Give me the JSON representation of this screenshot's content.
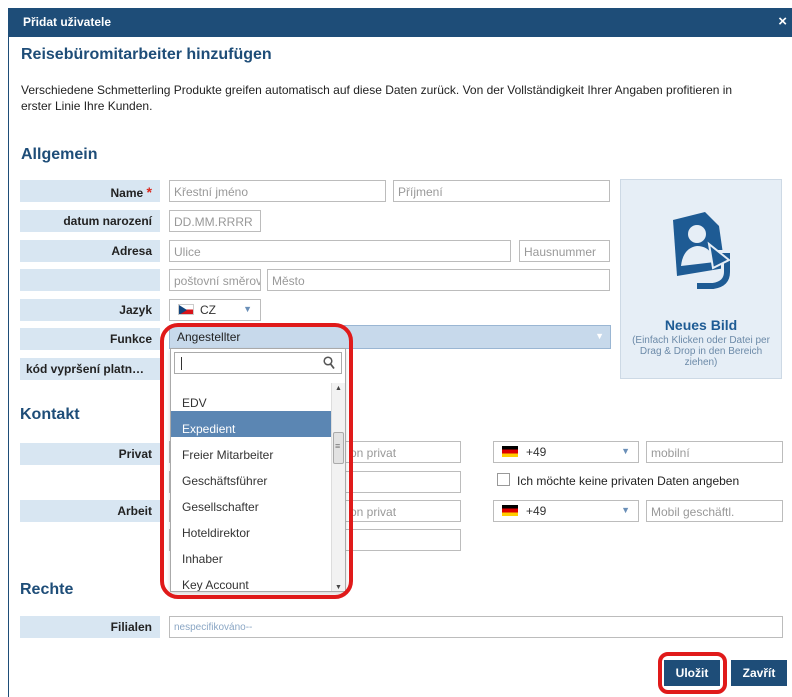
{
  "dialog": {
    "title": "Přidat uživatele",
    "close_glyph": "×",
    "heading": "Reisebüromitarbeiter hinzufügen",
    "intro_line1": "Verschiedene Schmetterling Produkte greifen automatisch auf diese Daten zurück. Von der Vollständigkeit Ihrer Angaben profitieren in",
    "intro_line2": "erster Linie Ihre Kunden."
  },
  "sections": {
    "general": "Allgemein",
    "contact": "Kontakt",
    "rights": "Rechte"
  },
  "general": {
    "name_label": "Name",
    "required_mark": "*",
    "firstname_placeholder": "Křestní jméno",
    "lastname_placeholder": "Příjmení",
    "birthdate_label": "datum narození",
    "birthdate_placeholder": "DD.MM.RRRR",
    "address_label": "Adresa",
    "street_placeholder": "Ulice",
    "housenumber_placeholder": "Hausnummer",
    "postcode_placeholder": "poštovní směrová",
    "city_placeholder": "Město",
    "language_label": "Jazyk",
    "language_value": "CZ",
    "function_label": "Funkce",
    "function_value": "Angestellter",
    "expiry_label": "kód vypršení platn…"
  },
  "photo": {
    "title": "Neues Bild",
    "hint": "(Einfach Klicken oder Datei per Drag & Drop in den Bereich ziehen)"
  },
  "dropdown": {
    "search_value": "",
    "items": [
      "EDV",
      "Expedient",
      "Freier Mitarbeiter",
      "Geschäftsführer",
      "Gesellschafter",
      "Hoteldirektor",
      "Inhaber",
      "Key Account"
    ],
    "highlighted_index": 1
  },
  "contact": {
    "private_label": "Privat",
    "private_phone_partial": "on privat",
    "private_prefix": "+49",
    "private_mobile_placeholder": "mobilní",
    "no_private_data_label": "Ich möchte keine privaten Daten angeben",
    "work_label": "Arbeit",
    "work_phone_partial": "on privat",
    "work_prefix": "+49",
    "work_mobile_placeholder": "Mobil geschäftl."
  },
  "rights": {
    "branches_label": "Filialen",
    "branches_value": "nespecifikováno--"
  },
  "buttons": {
    "save": "Uložit",
    "close": "Zavřít"
  },
  "colors": {
    "brand": "#1e4d78",
    "label_bg": "#d8e6f2",
    "annotation": "#e01a1a",
    "highlight": "#5b86b3"
  }
}
